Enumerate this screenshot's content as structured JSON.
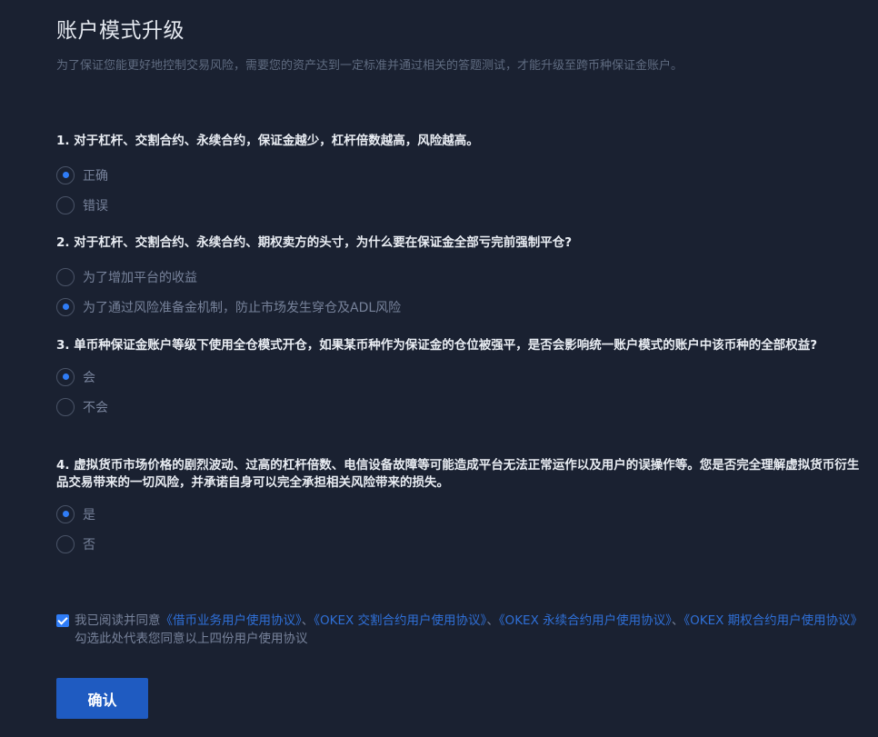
{
  "header": {
    "title": "账户模式升级",
    "subtitle": "为了保证您能更好地控制交易风险，需要您的资产达到一定标准并通过相关的答题测试，才能升级至跨币种保证金账户。"
  },
  "colors": {
    "background": "#1a2131",
    "accent": "#2f7cf6",
    "button": "#1f5bc1",
    "link": "#2f6fd6"
  },
  "questions": [
    {
      "text": "1. 对于杠杆、交割合约、永续合约，保证金越少，杠杆倍数越高，风险越高。",
      "options": [
        {
          "label": "正确",
          "selected": true
        },
        {
          "label": "错误",
          "selected": false
        }
      ]
    },
    {
      "text": "2. 对于杠杆、交割合约、永续合约、期权卖方的头寸，为什么要在保证金全部亏完前强制平仓?",
      "options": [
        {
          "label": "为了增加平台的收益",
          "selected": false
        },
        {
          "label": "为了通过风险准备金机制，防止市场发生穿仓及ADL风险",
          "selected": true
        }
      ]
    },
    {
      "text": "3. 单币种保证金账户等级下使用全仓模式开仓，如果某币种作为保证金的仓位被强平，是否会影响统一账户模式的账户中该币种的全部权益?",
      "options": [
        {
          "label": "会",
          "selected": true
        },
        {
          "label": "不会",
          "selected": false
        }
      ]
    },
    {
      "text": "4. 虚拟货币市场价格的剧烈波动、过高的杠杆倍数、电信设备故障等可能造成平台无法正常运作以及用户的误操作等。您是否完全理解虚拟货币衍生品交易带来的一切风险，并承诺自身可以完全承担相关风险带来的损失。",
      "options": [
        {
          "label": "是",
          "selected": true
        },
        {
          "label": "否",
          "selected": false
        }
      ]
    }
  ],
  "agreement": {
    "checked": true,
    "prefix": "我已阅读并同意",
    "link1": "《借币业务用户使用协议》",
    "sep1": "、",
    "link2": "《OKEX 交割合约用户使用协议》",
    "sep2": "、",
    "link3": "《OKEX 永续合约用户使用协议》",
    "sep3": "、",
    "link4": "《OKEX 期权合约用户使用协议》",
    "suffix": "勾选此处代表您同意以上四份用户使用协议"
  },
  "confirm_label": "确认"
}
